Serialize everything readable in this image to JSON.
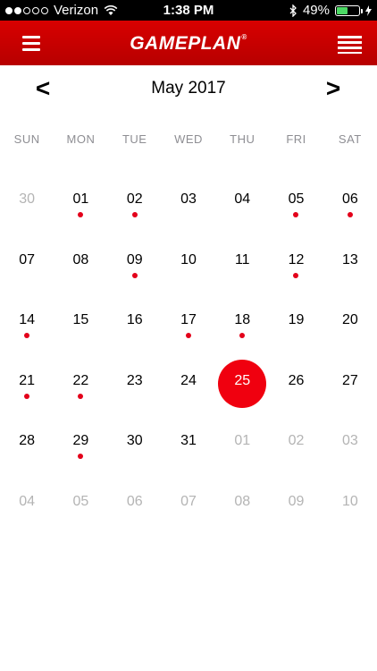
{
  "status_bar": {
    "carrier": "Verizon",
    "time": "1:38 PM",
    "battery": "49%",
    "battery_level": 0.49
  },
  "header": {
    "title": "GAMEPLAN",
    "registered": "®",
    "menu_icon": "hamburger-menu-icon",
    "list_icon": "list-view-icon"
  },
  "calendar": {
    "month_label": "May 2017",
    "prev_label": "<",
    "next_label": ">",
    "weekdays": [
      "SUN",
      "MON",
      "TUE",
      "WED",
      "THU",
      "FRI",
      "SAT"
    ],
    "weeks": [
      [
        {
          "day": "30",
          "in_month": false,
          "event": false
        },
        {
          "day": "01",
          "in_month": true,
          "event": true
        },
        {
          "day": "02",
          "in_month": true,
          "event": true
        },
        {
          "day": "03",
          "in_month": true,
          "event": false
        },
        {
          "day": "04",
          "in_month": true,
          "event": false
        },
        {
          "day": "05",
          "in_month": true,
          "event": true
        },
        {
          "day": "06",
          "in_month": true,
          "event": true
        }
      ],
      [
        {
          "day": "07",
          "in_month": true,
          "event": false
        },
        {
          "day": "08",
          "in_month": true,
          "event": false
        },
        {
          "day": "09",
          "in_month": true,
          "event": true
        },
        {
          "day": "10",
          "in_month": true,
          "event": false
        },
        {
          "day": "11",
          "in_month": true,
          "event": false
        },
        {
          "day": "12",
          "in_month": true,
          "event": true
        },
        {
          "day": "13",
          "in_month": true,
          "event": false
        }
      ],
      [
        {
          "day": "14",
          "in_month": true,
          "event": true
        },
        {
          "day": "15",
          "in_month": true,
          "event": false
        },
        {
          "day": "16",
          "in_month": true,
          "event": false
        },
        {
          "day": "17",
          "in_month": true,
          "event": true
        },
        {
          "day": "18",
          "in_month": true,
          "event": true
        },
        {
          "day": "19",
          "in_month": true,
          "event": false
        },
        {
          "day": "20",
          "in_month": true,
          "event": false
        }
      ],
      [
        {
          "day": "21",
          "in_month": true,
          "event": true
        },
        {
          "day": "22",
          "in_month": true,
          "event": true
        },
        {
          "day": "23",
          "in_month": true,
          "event": false
        },
        {
          "day": "24",
          "in_month": true,
          "event": false
        },
        {
          "day": "25",
          "in_month": true,
          "event": false,
          "selected": true
        },
        {
          "day": "26",
          "in_month": true,
          "event": false
        },
        {
          "day": "27",
          "in_month": true,
          "event": false
        }
      ],
      [
        {
          "day": "28",
          "in_month": true,
          "event": false
        },
        {
          "day": "29",
          "in_month": true,
          "event": true
        },
        {
          "day": "30",
          "in_month": true,
          "event": false
        },
        {
          "day": "31",
          "in_month": true,
          "event": false
        },
        {
          "day": "01",
          "in_month": false,
          "event": false
        },
        {
          "day": "02",
          "in_month": false,
          "event": false
        },
        {
          "day": "03",
          "in_month": false,
          "event": false
        }
      ],
      [
        {
          "day": "04",
          "in_month": false,
          "event": false
        },
        {
          "day": "05",
          "in_month": false,
          "event": false
        },
        {
          "day": "06",
          "in_month": false,
          "event": false
        },
        {
          "day": "07",
          "in_month": false,
          "event": false
        },
        {
          "day": "08",
          "in_month": false,
          "event": false
        },
        {
          "day": "09",
          "in_month": false,
          "event": false
        },
        {
          "day": "10",
          "in_month": false,
          "event": false
        }
      ]
    ]
  },
  "colors": {
    "header": "#c80000",
    "accent": "#f0000f",
    "event_dot": "#e3001a",
    "muted": "#b4b4b4",
    "weekday": "#8e8e93"
  }
}
